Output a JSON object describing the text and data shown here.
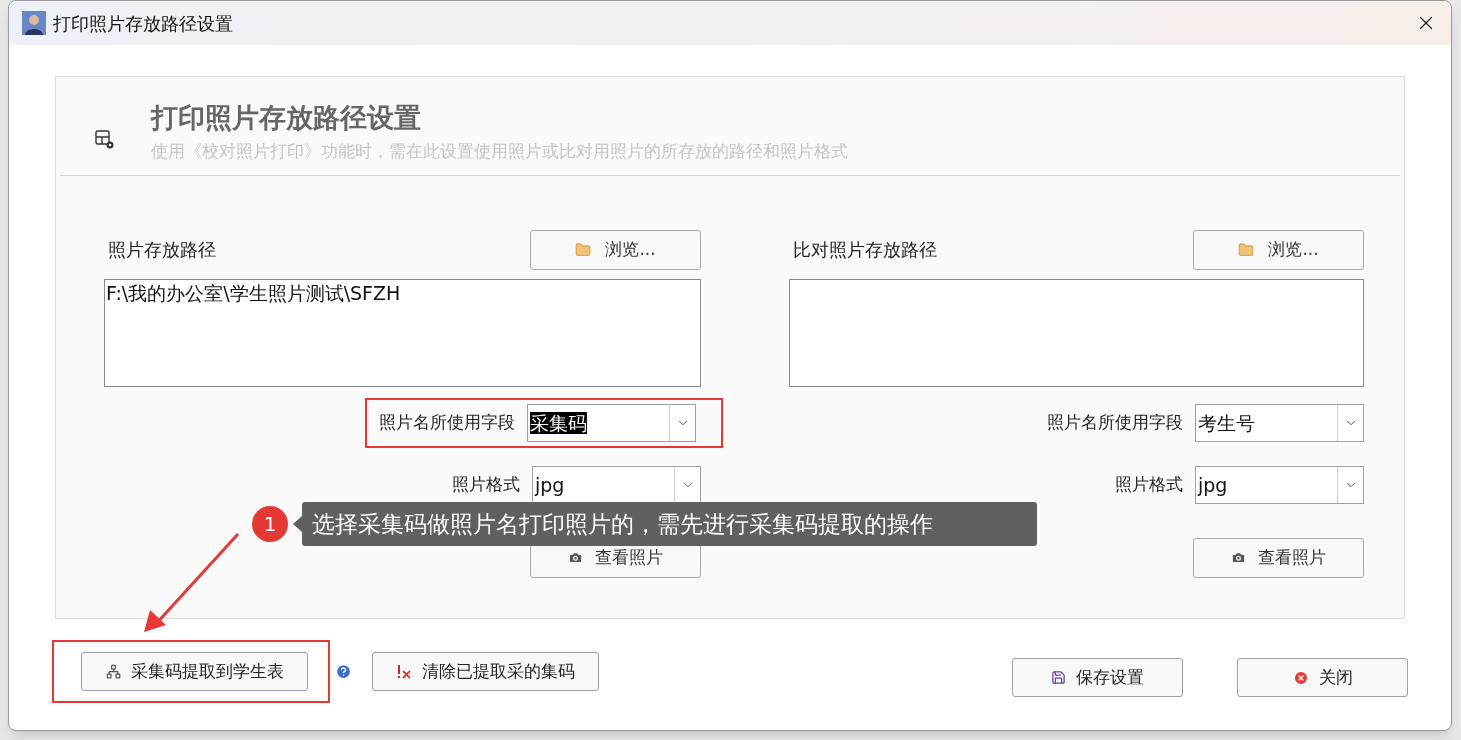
{
  "window": {
    "title": "打印照片存放路径设置"
  },
  "header": {
    "title": "打印照片存放路径设置",
    "subtitle": "使用《校对照片打印》功能时，需在此设置使用照片或比对用照片的所存放的路径和照片格式"
  },
  "columns": [
    {
      "label": "照片存放路径",
      "browse_button": "浏览...",
      "path": "F:\\我的办公室\\学生照片测试\\SFZH",
      "field_label": "照片名所使用字段",
      "field_value": "采集码",
      "field_value_selected": true,
      "highlighted": true,
      "format_label": "照片格式",
      "format_value": "jpg",
      "view_button": "查看照片"
    },
    {
      "label": "比对照片存放路径",
      "browse_button": "浏览...",
      "field_label": "照片名所使用字段",
      "field_value": "考生号",
      "field_value_selected": false,
      "highlighted": false,
      "format_label": "照片格式",
      "format_value": "jpg",
      "view_button": "查看照片"
    }
  ],
  "annotation": {
    "badge": "1",
    "text": "选择采集码做照片名打印照片的，需先进行采集码提取的操作"
  },
  "footer_left": [
    {
      "kind": "extract",
      "label": "采集码提取到学生表",
      "highlighted": true
    },
    {
      "kind": "clear",
      "label": "清除已提取采的集码",
      "highlighted": false
    }
  ],
  "footer_right": [
    {
      "kind": "save",
      "label": "保存设置"
    },
    {
      "kind": "close",
      "label": "关闭"
    }
  ]
}
